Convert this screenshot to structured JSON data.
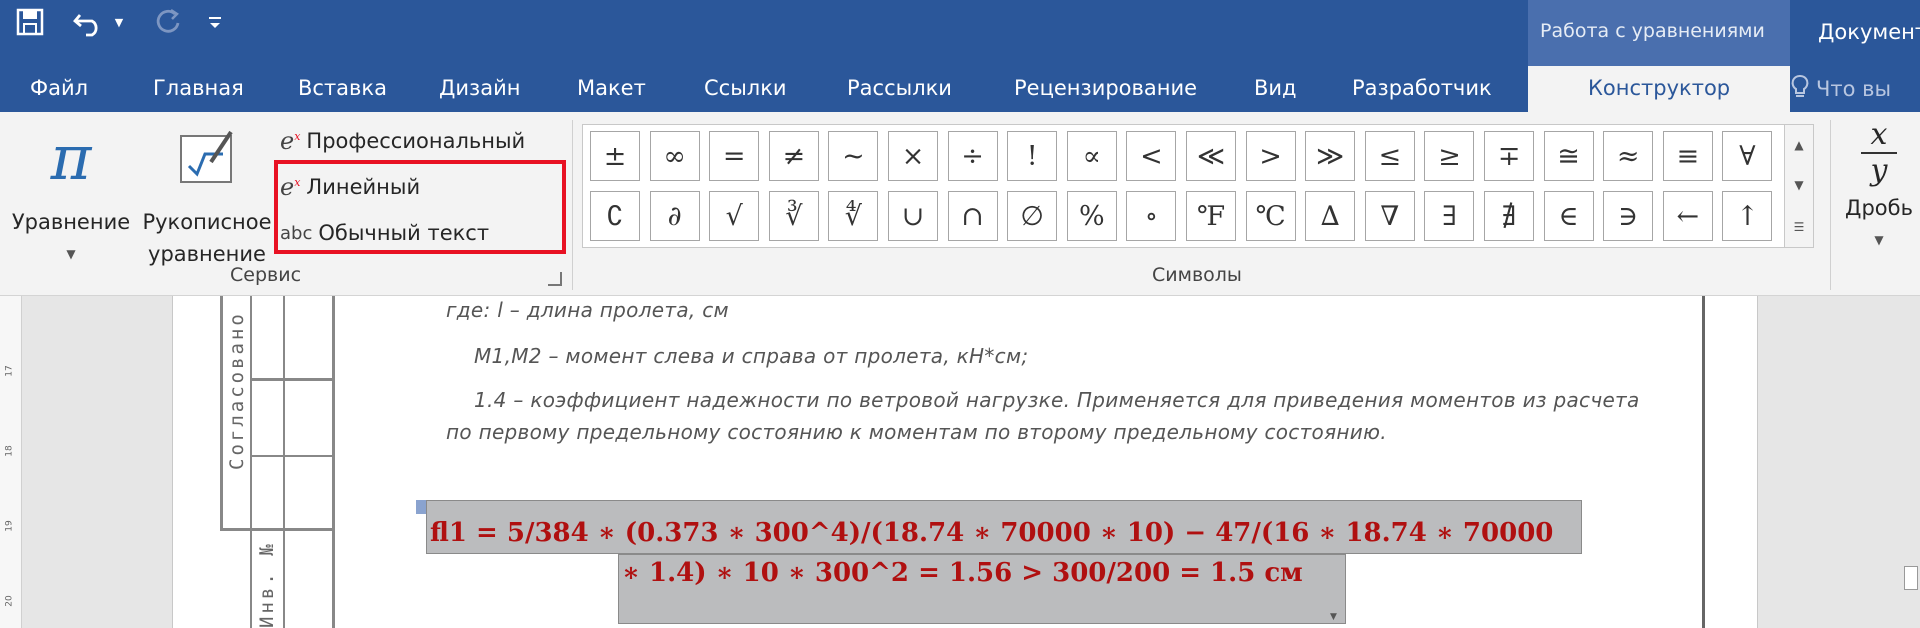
{
  "app": {
    "context_group": "Работа с уравнениями",
    "document_title": "Документ"
  },
  "qat": {
    "save_icon": "save-icon",
    "undo_icon": "undo-icon",
    "redo_icon": "redo-icon",
    "customize_icon": "customize-qat-icon"
  },
  "tabs": [
    "Файл",
    "Главная",
    "Вставка",
    "Дизайн",
    "Макет",
    "Ссылки",
    "Рассылки",
    "Рецензирование",
    "Вид",
    "Разработчик"
  ],
  "active_tab": "Конструктор",
  "tell_me": "Что вы",
  "ribbon": {
    "equation_label": "Уравнение",
    "ink_label_1": "Рукописное",
    "ink_label_2": "уравнение",
    "professional": "Профессиональный",
    "linear": "Линейный",
    "normal_text": "Обычный текст",
    "normal_text_icon": "abc",
    "service_group": "Сервис",
    "symbols_group": "Символы",
    "fraction_label": "Дробь",
    "fraction_num": "x",
    "fraction_den": "y"
  },
  "symbols_row1": [
    "±",
    "∞",
    "=",
    "≠",
    "~",
    "×",
    "÷",
    "!",
    "∝",
    "<",
    "≪",
    ">",
    "≫",
    "≤",
    "≥",
    "∓",
    "≅",
    "≈",
    "≡",
    "∀"
  ],
  "symbols_row2": [
    "∁",
    "∂",
    "√",
    "∛",
    "∜",
    "∪",
    "∩",
    "∅",
    "%",
    "∘",
    "℉",
    "℃",
    "∆",
    "∇",
    "∃",
    "∄",
    "∈",
    "∋",
    "←",
    "↑"
  ],
  "ruler_numbers": [
    "17",
    "18",
    "19",
    "20"
  ],
  "stamp": {
    "agreed": "Согласовано",
    "inv": "Инв. №"
  },
  "document": {
    "line1": "где: l – длина пролета, см",
    "line2": "M1,M2 – момент слева и справа от пролета, кН*см;",
    "line3": "1.4 – коэффициент надежности по ветровой нагрузке. Применяется для приведения моментов из расчета",
    "line4": "по первому предельному состоянию к моментам по второму предельному состоянию.",
    "eq_line1": "fl1 = 5/384 ∗ (0.373 ∗ 300^4)/(18.74 ∗ 70000 ∗ 10) − 47/(16 ∗ 18.74 ∗ 70000",
    "eq_line2": "∗ 1.4) ∗ 10 ∗ 300^2 = 1.56 > 300/200 = 1.5 см"
  },
  "colors": {
    "title_bar": "#2b579a",
    "ribbon": "#f3f3f3",
    "highlight": "#e81123",
    "equation_text": "#b01010",
    "equation_bg": "#bbbcbe"
  }
}
